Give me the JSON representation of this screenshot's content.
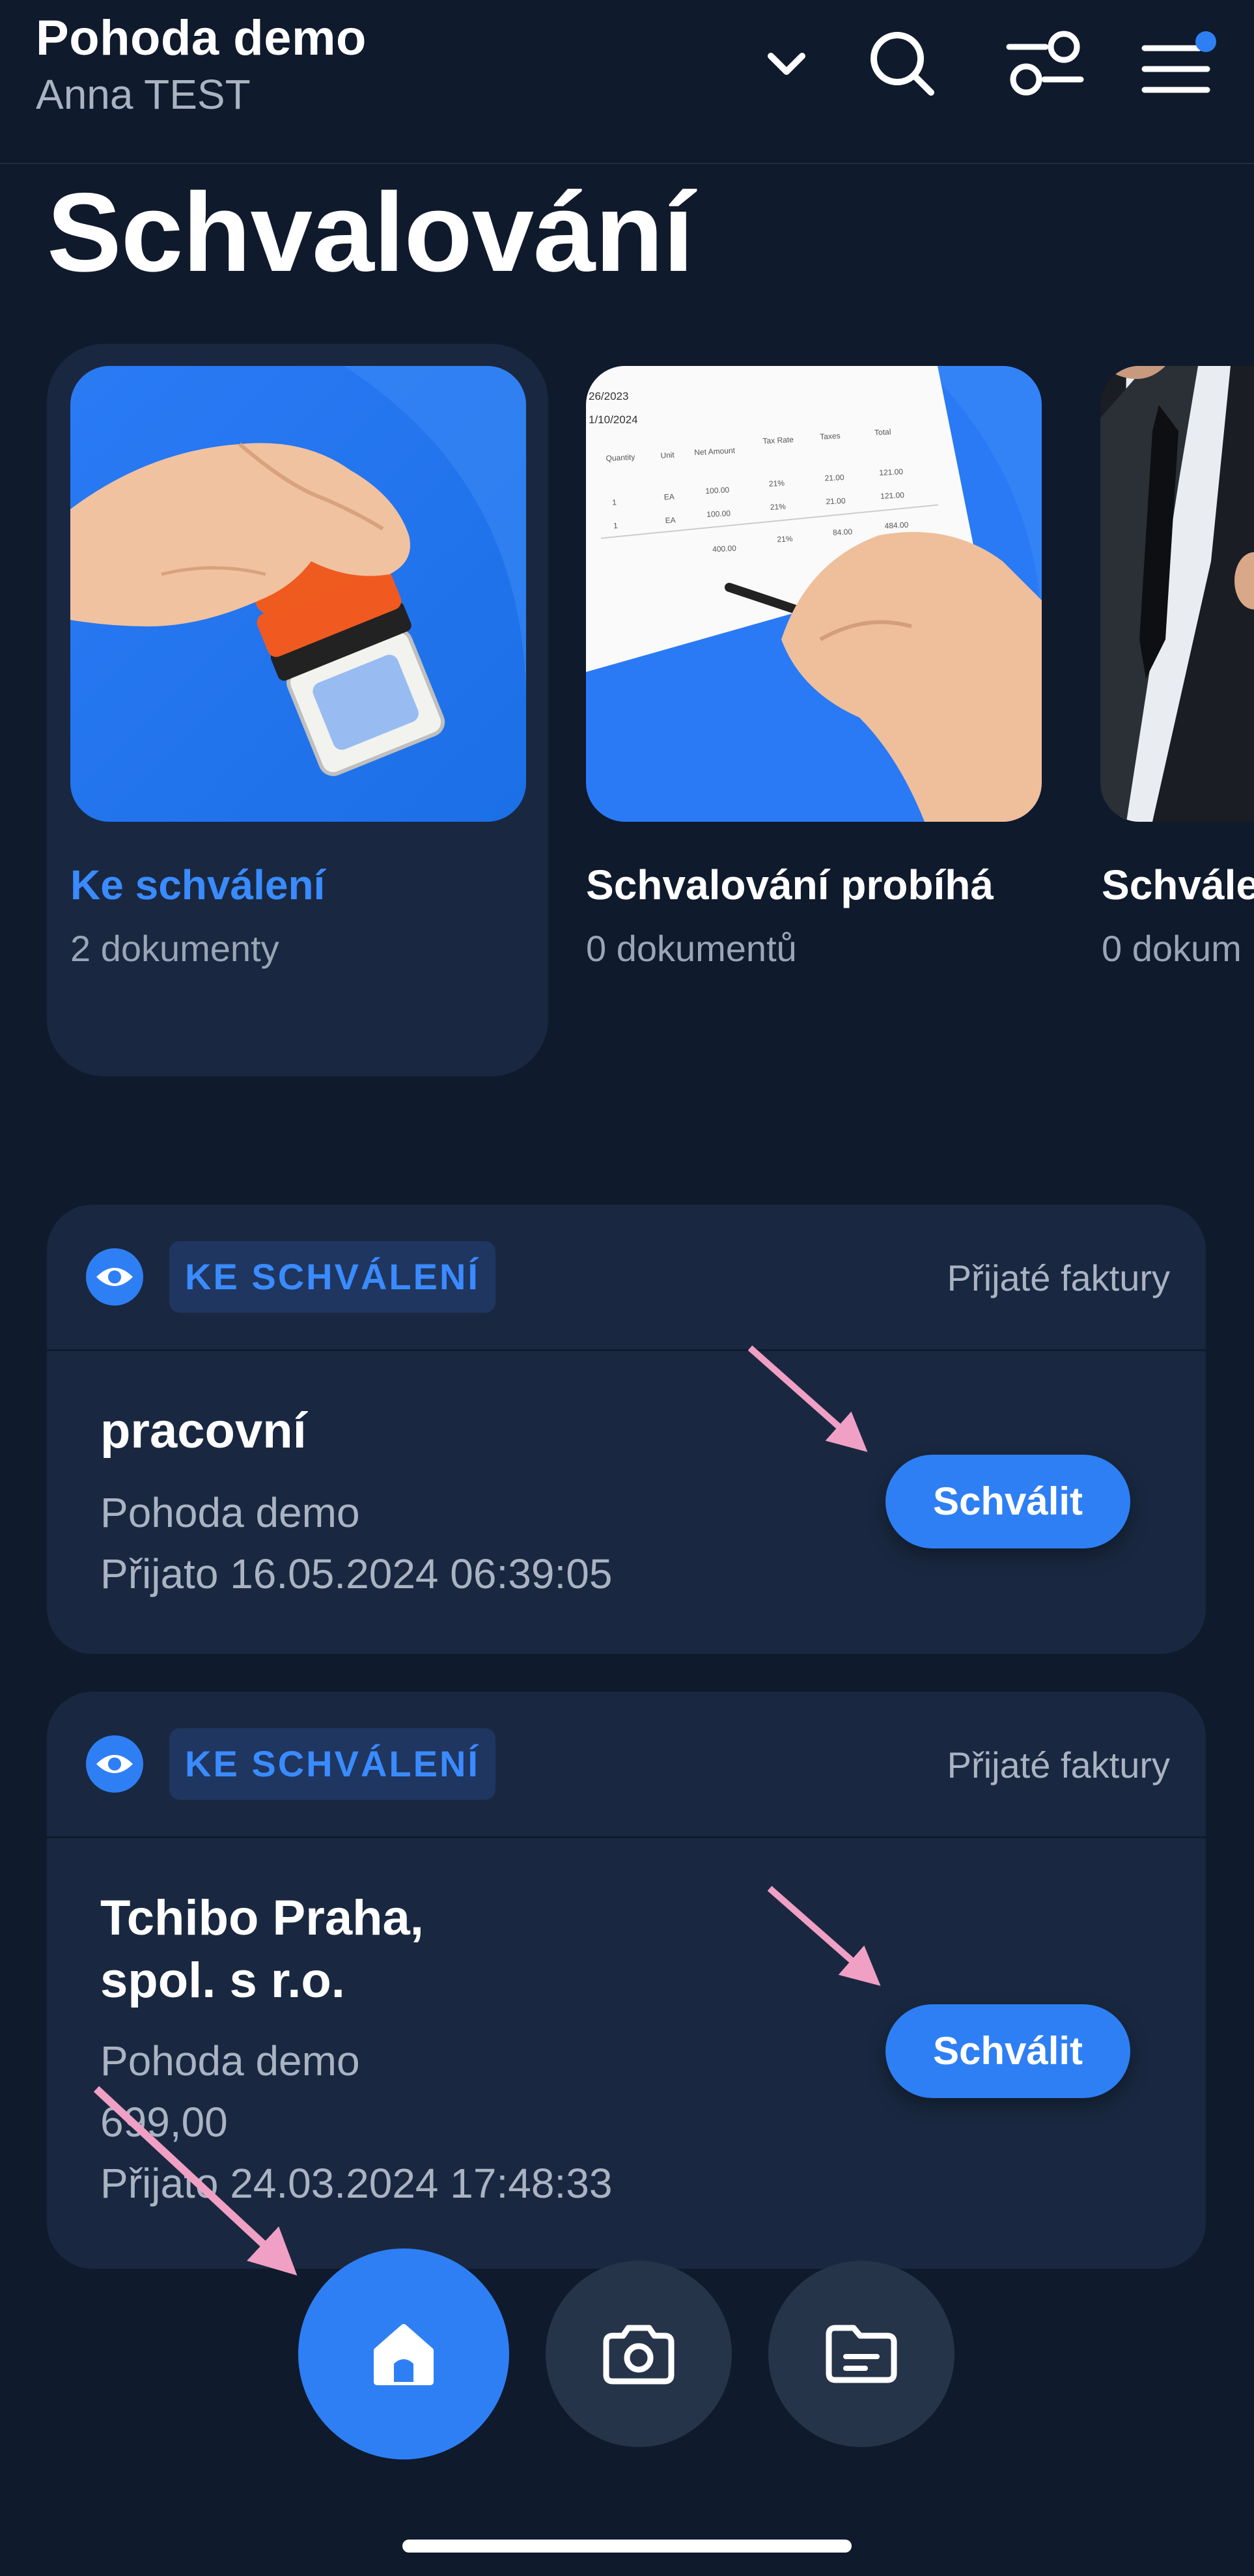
{
  "header": {
    "company": "Pohoda demo",
    "user": "Anna TEST",
    "icons": [
      "chevron-down-icon",
      "search-icon",
      "filter-icon",
      "menu-icon"
    ],
    "notification_dot_color": "#2f7ff4"
  },
  "page_title": "Schvalování",
  "categories": [
    {
      "title": "Ke schválení",
      "count": "2 dokumenty",
      "active": true
    },
    {
      "title": "Schvalování probíhá",
      "count": "0 dokumentů",
      "active": false
    },
    {
      "title": "Schvále",
      "count": "0 dokum",
      "active": false
    }
  ],
  "invoice_image": {
    "date1": "26/2023",
    "date2": "1/10/2024",
    "headers": [
      "Quantity",
      "Unit",
      "Net Amount",
      "Tax Rate",
      "Taxes",
      "Total"
    ],
    "rows": [
      [
        "1",
        "EA",
        "100.00",
        "21%",
        "21.00",
        "121.00"
      ],
      [
        "1",
        "EA",
        "100.00",
        "21%",
        "21.00",
        "121.00"
      ],
      [
        "",
        "",
        "400.00",
        "21%",
        "84.00",
        "484.00"
      ]
    ]
  },
  "documents": [
    {
      "status": "KE SCHVÁLENÍ",
      "type": "Přijaté faktury",
      "name_lines": [
        "pracovní"
      ],
      "company": "Pohoda demo",
      "amount": "",
      "received": "Přijato 16.05.2024 06:39:05",
      "action": "Schválit"
    },
    {
      "status": "KE SCHVÁLENÍ",
      "type": "Přijaté faktury",
      "name_lines": [
        "Tchibo Praha,",
        "spol. s r.o."
      ],
      "company": "Pohoda demo",
      "amount": "699,00",
      "received": "Přijato 24.03.2024 17:48:33",
      "action": "Schválit"
    }
  ],
  "bottom_nav": {
    "items": [
      "home-icon",
      "camera-icon",
      "folder-icon"
    ],
    "active": "home-icon"
  },
  "colors": {
    "background": "#0f1a2c",
    "card": "#192840",
    "accent": "#2f7ff4",
    "annotation_arrow": "#f0a0c4"
  }
}
